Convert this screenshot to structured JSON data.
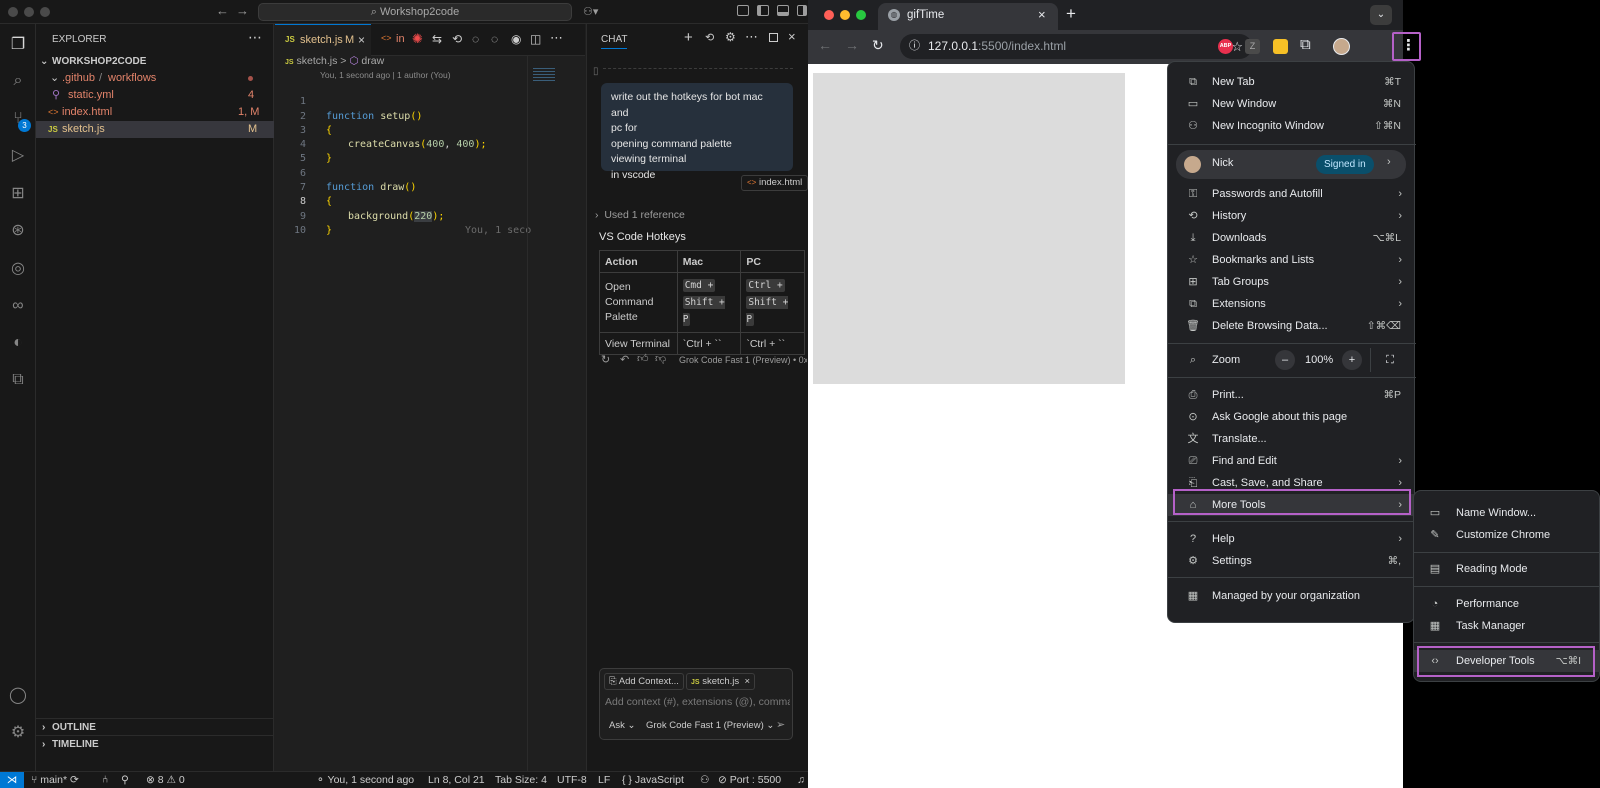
{
  "vscode": {
    "search_text": "Workshop2code",
    "explorer": {
      "title": "EXPLORER",
      "project": "WORKSHOP2CODE",
      "items": [
        {
          "folder1": ".github",
          "sep": "/",
          "folder2": "workflows",
          "badge": ""
        },
        {
          "label": "static.yml",
          "badge": "4"
        },
        {
          "label": "index.html",
          "badge": "1, M"
        },
        {
          "label": "sketch.js",
          "badge": "M"
        }
      ],
      "outline": "OUTLINE",
      "timeline": "TIMELINE"
    },
    "activity_badge": "3",
    "editor": {
      "tab_label": "sketch.js",
      "tab_mod": "M",
      "tab2_label": "in",
      "breadcrumb_file": "sketch.js",
      "breadcrumb_sep": ">",
      "breadcrumb_symbol": "draw",
      "blame_header": "You, 1 second ago | 1 author (You)",
      "inline_blame": "You, 1 seco",
      "lines": [
        "1",
        "2",
        "3",
        "4",
        "5",
        "6",
        "7",
        "8",
        "9",
        "10"
      ],
      "code": {
        "l1_kw": "function",
        "l1_fn": "setup",
        "l1_p": "()",
        "l2": "{",
        "l3_fn": "createCanvas",
        "l3_a": "(",
        "l3_n1": "400",
        "l3_c": ", ",
        "l3_n2": "400",
        "l3_b": ");",
        "l4": "}",
        "l6_kw": "function",
        "l6_fn": "draw",
        "l6_p": "()",
        "l7": "{",
        "l8_fn": "background",
        "l8_a": "(",
        "l8_n": "220",
        "l8_b": ");",
        "l9": "}"
      }
    },
    "chat": {
      "title": "CHAT",
      "user_message": [
        "write out the hotkeys for bot mac and",
        "pc for",
        "opening command palette",
        "viewing terminal",
        "in vscode"
      ],
      "attachment": "index.html",
      "used_reference": "Used 1 reference",
      "heading": "VS Code Hotkeys",
      "table": {
        "headers": [
          "Action",
          "Mac",
          "PC"
        ],
        "row1_action": [
          "Open",
          "Command",
          "Palette"
        ],
        "row1_mac": [
          "Cmd +",
          "Shift + P"
        ],
        "row1_pc": [
          "Ctrl +",
          "Shift + P"
        ],
        "row2_action": "View Terminal",
        "row2_mac": "`Ctrl + ``",
        "row2_pc": "`Ctrl + ``"
      },
      "model_footer": "Grok Code Fast 1 (Preview) • 0x",
      "add_context": "Add Context...",
      "context_file": "sketch.js",
      "input_placeholder": "Add context (#), extensions (@), commands",
      "mode": "Ask",
      "model": "Grok Code Fast 1 (Preview)"
    },
    "status": {
      "branch": "main*",
      "problems": "8",
      "warnings": "0",
      "blame": "You, 1 second ago",
      "position": "Ln 8, Col 21",
      "tab_size": "Tab Size: 4",
      "encoding": "UTF-8",
      "eol": "LF",
      "language": "JavaScript",
      "port": "Port : 5500"
    }
  },
  "chrome": {
    "tab_title": "gifTime",
    "url": "127.0.0.1:5500/index.html",
    "url_host": "127.0.0.1",
    "url_rest": ":5500/index.html",
    "ext_abp": "ABP",
    "menu": {
      "new_tab": "New Tab",
      "new_tab_sc": "⌘T",
      "new_window": "New Window",
      "new_window_sc": "⌘N",
      "new_incognito": "New Incognito Window",
      "new_incognito_sc": "⇧⌘N",
      "profile_name": "Nick",
      "signed_in": "Signed in",
      "passwords": "Passwords and Autofill",
      "history": "History",
      "downloads": "Downloads",
      "downloads_sc": "⌥⌘L",
      "bookmarks": "Bookmarks and Lists",
      "tab_groups": "Tab Groups",
      "extensions": "Extensions",
      "delete_data": "Delete Browsing Data...",
      "delete_data_sc": "⇧⌘⌫",
      "zoom": "Zoom",
      "zoom_minus": "–",
      "zoom_value": "100%",
      "zoom_plus": "+",
      "print": "Print...",
      "print_sc": "⌘P",
      "ask_google": "Ask Google about this page",
      "translate": "Translate...",
      "find_edit": "Find and Edit",
      "cast_save": "Cast, Save, and Share",
      "more_tools": "More Tools",
      "help": "Help",
      "settings": "Settings",
      "settings_sc": "⌘,",
      "managed": "Managed by your organization"
    },
    "submenu": {
      "name_window": "Name Window...",
      "customize": "Customize Chrome",
      "reading_mode": "Reading Mode",
      "performance": "Performance",
      "task_manager": "Task Manager",
      "dev_tools": "Developer Tools",
      "dev_tools_sc": "⌥⌘I"
    }
  },
  "colors": {
    "vscode_bg": "#1f1f1f",
    "highlight": "#b561c8",
    "accent_blue": "#0078d4"
  }
}
